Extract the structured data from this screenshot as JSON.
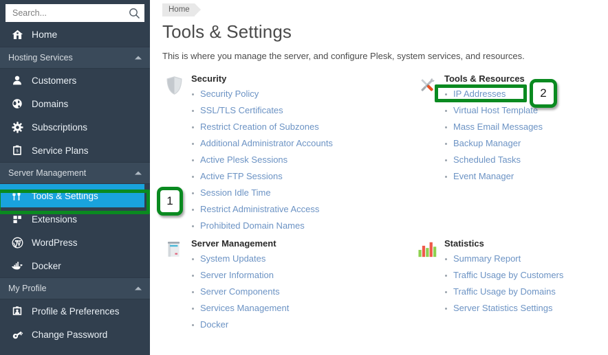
{
  "colors": {
    "sidebar_bg": "#313f4e",
    "sidebar_group_bg": "#3a4a5a",
    "active_item_bg": "#19a3dd",
    "annotation_green": "#0a8a20",
    "link_blue": "#6c93c4"
  },
  "sidebar": {
    "search": {
      "placeholder": "Search...",
      "value": "",
      "icon": "search-icon"
    },
    "home": {
      "label": "Home",
      "icon": "home-icon"
    },
    "groups": [
      {
        "label": "Hosting Services",
        "caret": "chevron-up-icon",
        "items": [
          {
            "label": "Customers",
            "icon": "user-icon",
            "active": false
          },
          {
            "label": "Domains",
            "icon": "globe-icon",
            "active": false
          },
          {
            "label": "Subscriptions",
            "icon": "gear-icon",
            "active": false
          },
          {
            "label": "Service Plans",
            "icon": "clipboard-icon",
            "active": false
          }
        ]
      },
      {
        "label": "Server Management",
        "caret": "chevron-up-icon",
        "items": [
          {
            "label": "Tools & Settings",
            "icon": "fork-knife-icon",
            "active": true
          },
          {
            "label": "Extensions",
            "icon": "blocks-icon",
            "active": false
          },
          {
            "label": "WordPress",
            "icon": "wordpress-icon",
            "active": false
          },
          {
            "label": "Docker",
            "icon": "docker-whale-icon",
            "active": false
          }
        ]
      },
      {
        "label": "My Profile",
        "caret": "chevron-up-icon",
        "items": [
          {
            "label": "Profile & Preferences",
            "icon": "id-card-icon",
            "active": false
          },
          {
            "label": "Change Password",
            "icon": "key-icon",
            "active": false
          }
        ]
      }
    ]
  },
  "main": {
    "breadcrumb": [
      "Home"
    ],
    "title": "Tools & Settings",
    "subtitle": "This is where you manage the server, and configure Plesk, system services, and resources.",
    "groups": [
      {
        "title": "Security",
        "icon": "shield-icon",
        "column": "left",
        "links": [
          "Security Policy",
          "SSL/TLS Certificates",
          "Restrict Creation of Subzones",
          "Additional Administrator Accounts",
          "Active Plesk Sessions",
          "Active FTP Sessions",
          "Session Idle Time",
          "Restrict Administrative Access",
          "Prohibited Domain Names"
        ]
      },
      {
        "title": "Tools & Resources",
        "icon": "wrench-screwdriver-icon",
        "column": "right",
        "links": [
          "IP Addresses",
          "Virtual Host Template",
          "Mass Email Messages",
          "Backup Manager",
          "Scheduled Tasks",
          "Event Manager"
        ]
      },
      {
        "title": "Server Management",
        "icon": "server-icon",
        "column": "left",
        "links": [
          "System Updates",
          "Server Information",
          "Server Components",
          "Services Management",
          "Docker"
        ]
      },
      {
        "title": "Statistics",
        "icon": "bar-chart-icon",
        "column": "right",
        "links": [
          "Summary Report",
          "Traffic Usage by Customers",
          "Traffic Usage by Domains",
          "Server Statistics Settings"
        ]
      }
    ]
  },
  "annotations": [
    {
      "number": "1",
      "target": "sidebar-item-tools-settings"
    },
    {
      "number": "2",
      "target": "link-ip-addresses"
    }
  ]
}
